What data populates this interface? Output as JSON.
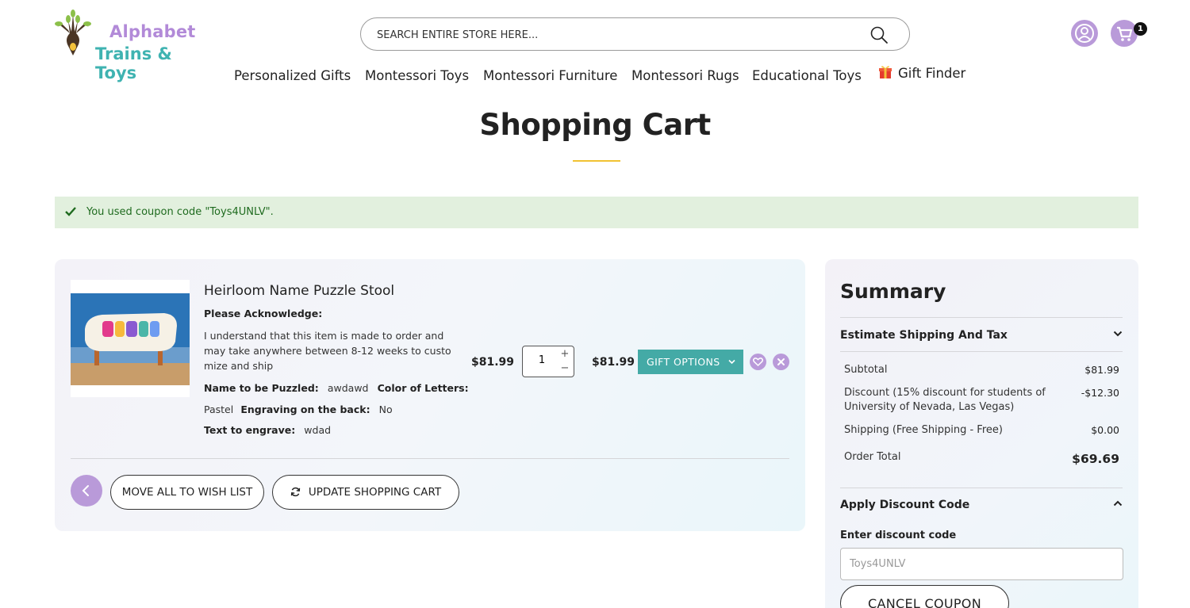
{
  "brand": {
    "line1": "Alphabet",
    "line2": "Trains & Toys",
    "colors": {
      "purple": "#b28ad8",
      "teal": "#3fb3b1"
    }
  },
  "header": {
    "search_placeholder": "SEARCH ENTIRE STORE HERE...",
    "cart_count": "1"
  },
  "nav": {
    "items": [
      {
        "label": "Personalized Gifts"
      },
      {
        "label": "Montessori Toys"
      },
      {
        "label": "Montessori Furniture"
      },
      {
        "label": "Montessori Rugs"
      },
      {
        "label": "Educational Toys"
      },
      {
        "label": "Gift Finder",
        "icon": "gift-icon"
      }
    ]
  },
  "page": {
    "title": "Shopping Cart",
    "notice": "You used coupon code \"Toys4UNLV\"."
  },
  "cart": {
    "item": {
      "name": "Heirloom Name Puzzle Stool",
      "ack_label": "Please Acknowledge:",
      "ack_text": "I understand that this item is made to order and may take anywhere between 8-12 weeks to customize and ship",
      "name_label": "Name to be Puzzled:",
      "name_value": "awdawd",
      "color_label": "Color of Letters:",
      "color_value": "Pastel",
      "engrave_label": "Engraving on the back:",
      "engrave_value": "No",
      "text_label": "Text to engrave:",
      "text_value": "wdad",
      "price": "$81.99",
      "qty": "1",
      "subtotal": "$81.99",
      "gift_options_label": "GIFT OPTIONS"
    },
    "move_all_label": "MOVE ALL TO WISH LIST",
    "update_label": "UPDATE SHOPPING CART"
  },
  "summary": {
    "title": "Summary",
    "shipping_tax_label": "Estimate Shipping And Tax",
    "subtotal_label": "Subtotal",
    "subtotal_value": "$81.99",
    "discount_label": "Discount (15% discount for students of University of Nevada, Las Vegas)",
    "discount_value": "-$12.30",
    "shipping_label": "Shipping (Free Shipping - Free)",
    "shipping_value": "$0.00",
    "order_total_label": "Order Total",
    "order_total_value": "$69.69",
    "discount_section_label": "Apply Discount Code",
    "discount_field_label": "Enter discount code",
    "discount_code_value": "Toys4UNLV",
    "cancel_coupon_label": "CANCEL COUPON"
  },
  "colors": {
    "accent_purple": "#b99ad9",
    "gift_button": "#44aaa6",
    "notice_bg": "#e2f0de",
    "notice_text": "#1f6b1f",
    "title_underline": "#f1c233"
  }
}
